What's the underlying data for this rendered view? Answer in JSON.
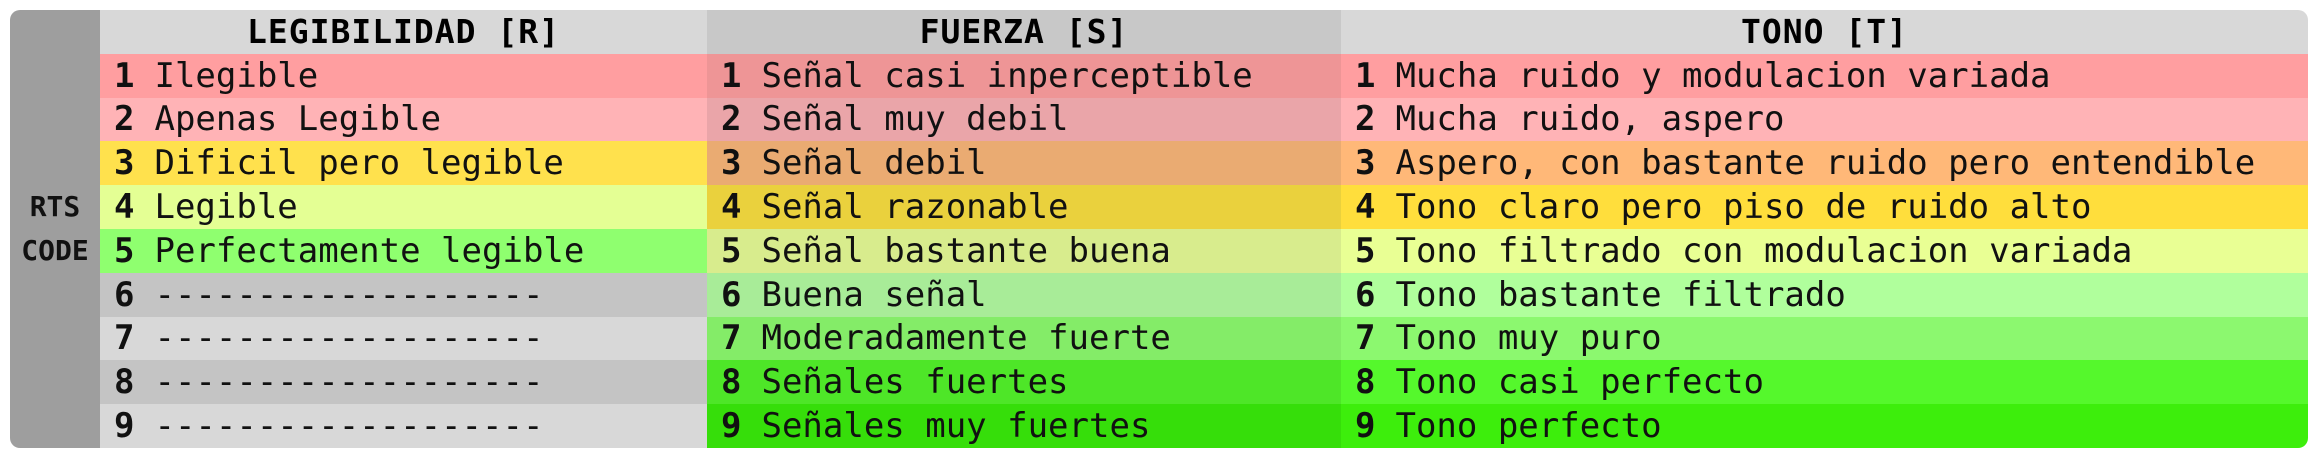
{
  "side_label": [
    "RTS",
    "CODE"
  ],
  "columns": [
    {
      "header": "LEGIBILIDAD [R]",
      "header_color": "#d8d8d8",
      "rows": [
        {
          "num": "1",
          "text": "Ilegible",
          "color": "#ff9ea0"
        },
        {
          "num": "2",
          "text": "Apenas Legible",
          "color": "#ffb3b6"
        },
        {
          "num": "3",
          "text": "Dificil pero legible",
          "color": "#ffe14d"
        },
        {
          "num": "4",
          "text": "Legible",
          "color": "#e4ff94"
        },
        {
          "num": "5",
          "text": "Perfectamente legible",
          "color": "#8fff6f"
        },
        {
          "num": "6",
          "text": "-------------------",
          "color": "#c4c4c4"
        },
        {
          "num": "7",
          "text": "-------------------",
          "color": "#d8d8d8"
        },
        {
          "num": "8",
          "text": "-------------------",
          "color": "#c4c4c4"
        },
        {
          "num": "9",
          "text": "-------------------",
          "color": "#d8d8d8"
        }
      ]
    },
    {
      "header": "FUERZA [S]",
      "header_color": "#c8c8c8",
      "rows": [
        {
          "num": "1",
          "text": "Señal casi inperceptible",
          "color": "#ee9596"
        },
        {
          "num": "2",
          "text": "Señal muy debil",
          "color": "#eaa5a9"
        },
        {
          "num": "3",
          "text": "Señal debil",
          "color": "#eaab72"
        },
        {
          "num": "4",
          "text": "Señal razonable",
          "color": "#ead13d"
        },
        {
          "num": "5",
          "text": "Señal bastante buena",
          "color": "#d8ec8d"
        },
        {
          "num": "6",
          "text": "Buena señal",
          "color": "#a8ec98"
        },
        {
          "num": "7",
          "text": "Moderadamente fuerte",
          "color": "#84ec68"
        },
        {
          "num": "8",
          "text": "Señales fuertes",
          "color": "#4ee628"
        },
        {
          "num": "9",
          "text": "Señales muy fuertes",
          "color": "#36de0a"
        }
      ]
    },
    {
      "header": "TONO [T]",
      "header_color": "#d8d8d8",
      "rows": [
        {
          "num": "1",
          "text": "Mucha ruido y modulacion variada",
          "color": "#ff9ea0"
        },
        {
          "num": "2",
          "text": "Mucha ruido, aspero",
          "color": "#ffb3b6"
        },
        {
          "num": "3",
          "text": "Aspero, con bastante ruido pero entendible",
          "color": "#ffb878"
        },
        {
          "num": "4",
          "text": "Tono claro pero piso de ruido alto",
          "color": "#ffde3c"
        },
        {
          "num": "5",
          "text": "Tono filtrado con modulacion variada",
          "color": "#e9ff94"
        },
        {
          "num": "6",
          "text": "Tono bastante filtrado",
          "color": "#b0ff9c"
        },
        {
          "num": "7",
          "text": "Tono muy puro",
          "color": "#8cf86f"
        },
        {
          "num": "8",
          "text": "Tono casi perfecto",
          "color": "#55f82c"
        },
        {
          "num": "9",
          "text": "Tono perfecto",
          "color": "#3dee0c"
        }
      ]
    }
  ]
}
